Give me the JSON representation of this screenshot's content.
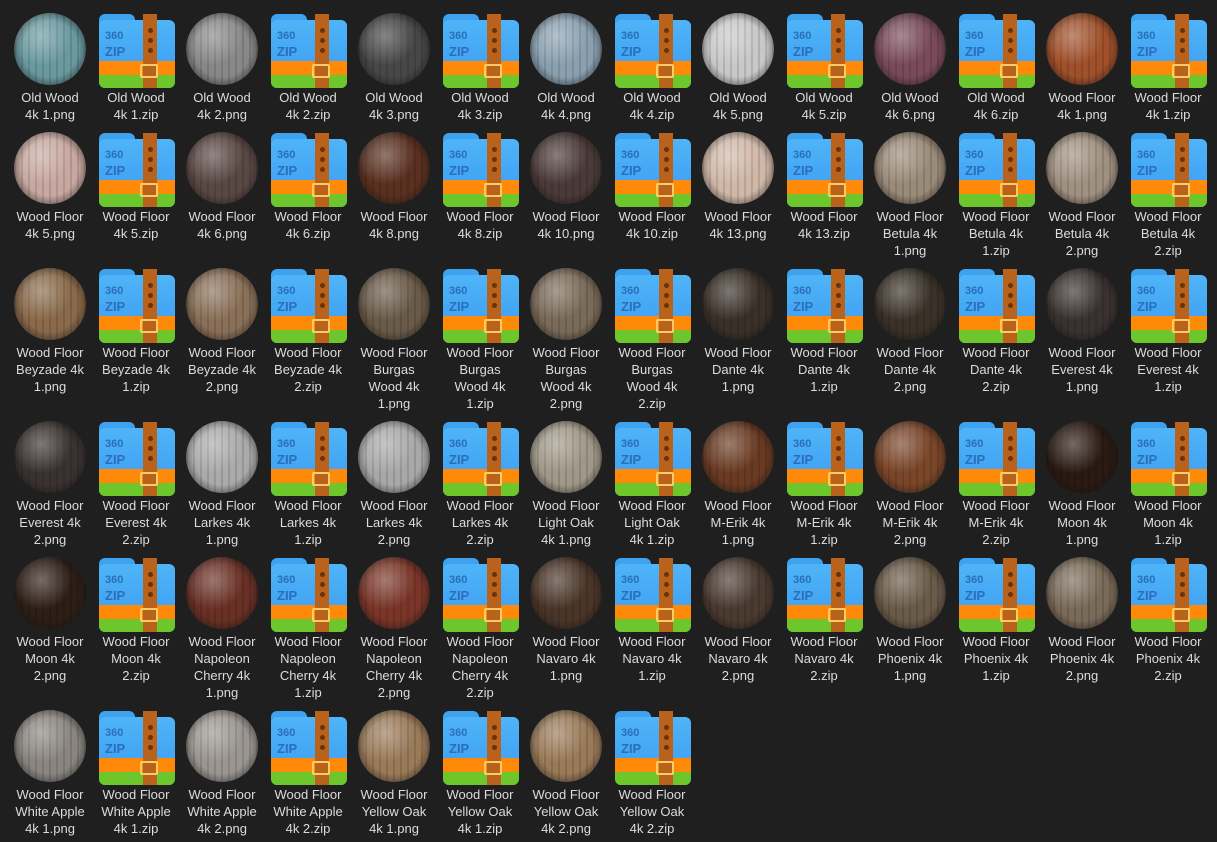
{
  "items": [
    {
      "name": "Old Wood\n4k 1.png",
      "type": "png",
      "color": "#6a9aa0"
    },
    {
      "name": "Old Wood\n4k 1.zip",
      "type": "zip"
    },
    {
      "name": "Old Wood\n4k 2.png",
      "type": "png",
      "color": "#888888"
    },
    {
      "name": "Old Wood\n4k 2.zip",
      "type": "zip"
    },
    {
      "name": "Old Wood\n4k 3.png",
      "type": "png",
      "color": "#474747"
    },
    {
      "name": "Old Wood\n4k 3.zip",
      "type": "zip"
    },
    {
      "name": "Old Wood\n4k 4.png",
      "type": "png",
      "color": "#8aa0b0"
    },
    {
      "name": "Old Wood\n4k 4.zip",
      "type": "zip"
    },
    {
      "name": "Old Wood\n4k 5.png",
      "type": "png",
      "color": "#c8c8c8"
    },
    {
      "name": "Old Wood\n4k 5.zip",
      "type": "zip"
    },
    {
      "name": "Old Wood\n4k 6.png",
      "type": "png",
      "color": "#7a4a5a"
    },
    {
      "name": "Old Wood\n4k 6.zip",
      "type": "zip"
    },
    {
      "name": "Wood Floor\n4k 1.png",
      "type": "png",
      "color": "#a0502a"
    },
    {
      "name": "Wood Floor\n4k 1.zip",
      "type": "zip"
    },
    {
      "name": "Wood Floor\n4k 5.png",
      "type": "png",
      "color": "#c8a8a0"
    },
    {
      "name": "Wood Floor\n4k 5.zip",
      "type": "zip"
    },
    {
      "name": "Wood Floor\n4k 6.png",
      "type": "png",
      "color": "#5a4844"
    },
    {
      "name": "Wood Floor\n4k 6.zip",
      "type": "zip"
    },
    {
      "name": "Wood Floor\n4k 8.png",
      "type": "png",
      "color": "#5a3020"
    },
    {
      "name": "Wood Floor\n4k 8.zip",
      "type": "zip"
    },
    {
      "name": "Wood Floor\n4k 10.png",
      "type": "png",
      "color": "#4a3a38"
    },
    {
      "name": "Wood Floor\n4k 10.zip",
      "type": "zip"
    },
    {
      "name": "Wood Floor\n4k 13.png",
      "type": "png",
      "color": "#d0b8a8"
    },
    {
      "name": "Wood Floor\n4k 13.zip",
      "type": "zip"
    },
    {
      "name": "Wood Floor\nBetula 4k\n1.png",
      "type": "png",
      "color": "#9a8a78"
    },
    {
      "name": "Wood Floor\nBetula 4k\n1.zip",
      "type": "zip"
    },
    {
      "name": "Wood Floor\nBetula 4k\n2.png",
      "type": "png",
      "color": "#a09080"
    },
    {
      "name": "Wood Floor\nBetula 4k\n2.zip",
      "type": "zip"
    },
    {
      "name": "Wood Floor\nBeyzade 4k\n1.png",
      "type": "png",
      "color": "#8a6a4a"
    },
    {
      "name": "Wood Floor\nBeyzade 4k\n1.zip",
      "type": "zip"
    },
    {
      "name": "Wood Floor\nBeyzade 4k\n2.png",
      "type": "png",
      "color": "#8a7058"
    },
    {
      "name": "Wood Floor\nBeyzade 4k\n2.zip",
      "type": "zip"
    },
    {
      "name": "Wood Floor\nBurgas\nWood 4k\n1.png",
      "type": "png",
      "color": "#6a5a48"
    },
    {
      "name": "Wood Floor\nBurgas\nWood 4k\n1.zip",
      "type": "zip"
    },
    {
      "name": "Wood Floor\nBurgas\nWood 4k\n2.png",
      "type": "png",
      "color": "#7a6a58"
    },
    {
      "name": "Wood Floor\nBurgas\nWood 4k\n2.zip",
      "type": "zip"
    },
    {
      "name": "Wood Floor\nDante 4k\n1.png",
      "type": "png",
      "color": "#3a3028"
    },
    {
      "name": "Wood Floor\nDante 4k\n1.zip",
      "type": "zip"
    },
    {
      "name": "Wood Floor\nDante 4k\n2.png",
      "type": "png",
      "color": "#3a3228"
    },
    {
      "name": "Wood Floor\nDante 4k\n2.zip",
      "type": "zip"
    },
    {
      "name": "Wood Floor\nEverest 4k\n1.png",
      "type": "png",
      "color": "#3a3230"
    },
    {
      "name": "Wood Floor\nEverest 4k\n1.zip",
      "type": "zip"
    },
    {
      "name": "Wood Floor\nEverest 4k\n2.png",
      "type": "png",
      "color": "#3a3230"
    },
    {
      "name": "Wood Floor\nEverest 4k\n2.zip",
      "type": "zip"
    },
    {
      "name": "Wood Floor\nLarkes 4k\n1.png",
      "type": "png",
      "color": "#aaaaaa"
    },
    {
      "name": "Wood Floor\nLarkes 4k\n1.zip",
      "type": "zip"
    },
    {
      "name": "Wood Floor\nLarkes 4k\n2.png",
      "type": "png",
      "color": "#a8a8a8"
    },
    {
      "name": "Wood Floor\nLarkes 4k\n2.zip",
      "type": "zip"
    },
    {
      "name": "Wood Floor\nLight Oak\n4k 1.png",
      "type": "png",
      "color": "#a09888"
    },
    {
      "name": "Wood Floor\nLight Oak\n4k 1.zip",
      "type": "zip"
    },
    {
      "name": "Wood Floor\nM-Erik 4k\n1.png",
      "type": "png",
      "color": "#6a3a22"
    },
    {
      "name": "Wood Floor\nM-Erik 4k\n1.zip",
      "type": "zip"
    },
    {
      "name": "Wood Floor\nM-Erik 4k\n2.png",
      "type": "png",
      "color": "#7a4528"
    },
    {
      "name": "Wood Floor\nM-Erik 4k\n2.zip",
      "type": "zip"
    },
    {
      "name": "Wood Floor\nMoon 4k\n1.png",
      "type": "png",
      "color": "#2a1a12"
    },
    {
      "name": "Wood Floor\nMoon 4k\n1.zip",
      "type": "zip"
    },
    {
      "name": "Wood Floor\nMoon 4k\n2.png",
      "type": "png",
      "color": "#2e1e16"
    },
    {
      "name": "Wood Floor\nMoon 4k\n2.zip",
      "type": "zip"
    },
    {
      "name": "Wood Floor\nNapoleon\nCherry 4k\n1.png",
      "type": "png",
      "color": "#6a3025"
    },
    {
      "name": "Wood Floor\nNapoleon\nCherry 4k\n1.zip",
      "type": "zip"
    },
    {
      "name": "Wood Floor\nNapoleon\nCherry 4k\n2.png",
      "type": "png",
      "color": "#7a3528"
    },
    {
      "name": "Wood Floor\nNapoleon\nCherry 4k\n2.zip",
      "type": "zip"
    },
    {
      "name": "Wood Floor\nNavaro 4k\n1.png",
      "type": "png",
      "color": "#4a3528"
    },
    {
      "name": "Wood Floor\nNavaro 4k\n1.zip",
      "type": "zip"
    },
    {
      "name": "Wood Floor\nNavaro 4k\n2.png",
      "type": "png",
      "color": "#4a3a30"
    },
    {
      "name": "Wood Floor\nNavaro 4k\n2.zip",
      "type": "zip"
    },
    {
      "name": "Wood Floor\nPhoenix 4k\n1.png",
      "type": "png",
      "color": "#6a5a48"
    },
    {
      "name": "Wood Floor\nPhoenix 4k\n1.zip",
      "type": "zip"
    },
    {
      "name": "Wood Floor\nPhoenix 4k\n2.png",
      "type": "png",
      "color": "#7a6a58"
    },
    {
      "name": "Wood Floor\nPhoenix 4k\n2.zip",
      "type": "zip"
    },
    {
      "name": "Wood Floor\nWhite Apple\n4k 1.png",
      "type": "png",
      "color": "#8a8580"
    },
    {
      "name": "Wood Floor\nWhite Apple\n4k 1.zip",
      "type": "zip"
    },
    {
      "name": "Wood Floor\nWhite Apple\n4k 2.png",
      "type": "png",
      "color": "#9a9590"
    },
    {
      "name": "Wood Floor\nWhite Apple\n4k 2.zip",
      "type": "zip"
    },
    {
      "name": "Wood Floor\nYellow Oak\n4k 1.png",
      "type": "png",
      "color": "#9a7a58"
    },
    {
      "name": "Wood Floor\nYellow Oak\n4k 1.zip",
      "type": "zip"
    },
    {
      "name": "Wood Floor\nYellow Oak\n4k 2.png",
      "type": "png",
      "color": "#9a7a58"
    },
    {
      "name": "Wood Floor\nYellow Oak\n4k 2.zip",
      "type": "zip"
    }
  ],
  "zip_icon": {
    "line1": "360",
    "line2": "ZIP"
  }
}
